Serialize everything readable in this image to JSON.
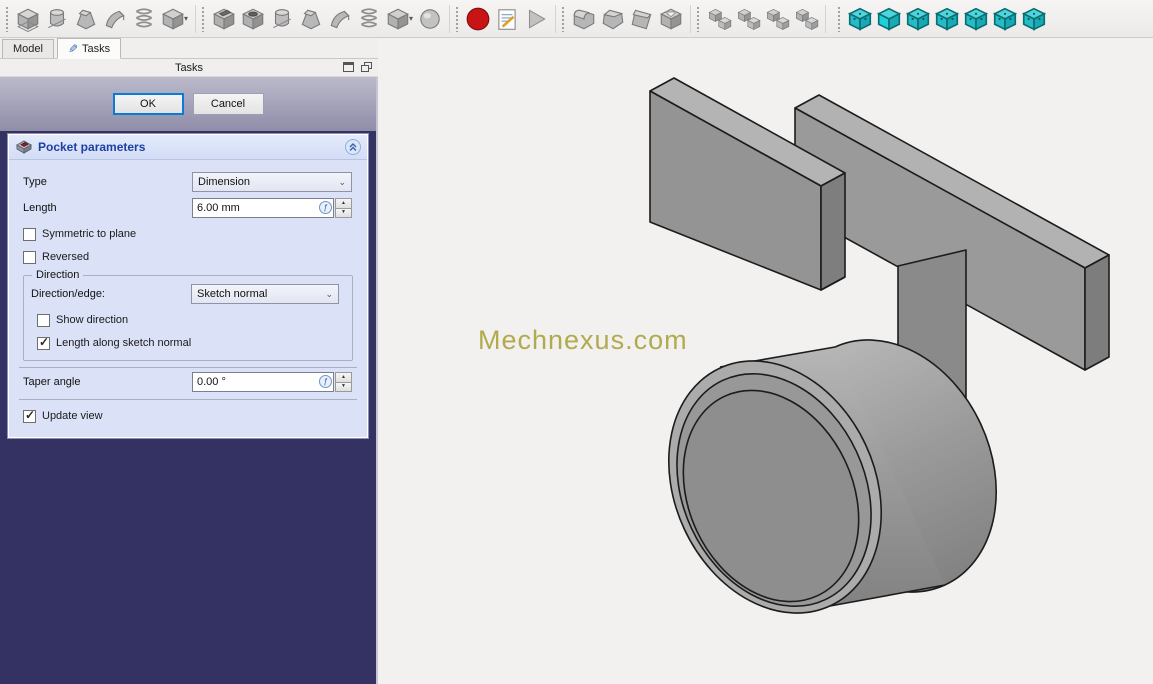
{
  "toolbar": {
    "groups": [
      {
        "name": "part-design-additive",
        "icons": [
          {
            "name": "pad-icon",
            "shape": "pad"
          },
          {
            "name": "revolution-icon",
            "shape": "rev"
          },
          {
            "name": "additive-loft-icon",
            "shape": "loft"
          },
          {
            "name": "additive-pipe-icon",
            "shape": "pipe"
          },
          {
            "name": "additive-helix-icon",
            "shape": "helix"
          },
          {
            "name": "additive-primitive-icon",
            "shape": "box",
            "dropdown": true
          }
        ]
      },
      {
        "name": "part-design-subtractive",
        "icons": [
          {
            "name": "pocket-icon",
            "shape": "pocket"
          },
          {
            "name": "hole-icon",
            "shape": "hole"
          },
          {
            "name": "groove-icon",
            "shape": "rev"
          },
          {
            "name": "subtractive-loft-icon",
            "shape": "loft"
          },
          {
            "name": "subtractive-pipe-icon",
            "shape": "pipe"
          },
          {
            "name": "subtractive-helix-icon",
            "shape": "helix"
          },
          {
            "name": "subtractive-primitive-icon",
            "shape": "box",
            "dropdown": true
          },
          {
            "name": "boolean-icon",
            "shape": "sphere"
          }
        ]
      },
      {
        "name": "macro",
        "icons": [
          {
            "name": "macro-record-icon",
            "shape": "record"
          },
          {
            "name": "macro-edit-icon",
            "shape": "doc"
          },
          {
            "name": "macro-execute-icon",
            "shape": "play"
          }
        ]
      },
      {
        "name": "dressup",
        "icons": [
          {
            "name": "fillet-icon",
            "shape": "fillet"
          },
          {
            "name": "chamfer-icon",
            "shape": "chamfer"
          },
          {
            "name": "draft-icon",
            "shape": "draft"
          },
          {
            "name": "thickness-icon",
            "shape": "thick"
          }
        ]
      },
      {
        "name": "transform",
        "icons": [
          {
            "name": "mirrored-icon",
            "shape": "cluster"
          },
          {
            "name": "linear-pattern-icon",
            "shape": "cluster"
          },
          {
            "name": "polar-pattern-icon",
            "shape": "cluster"
          },
          {
            "name": "multitransform-icon",
            "shape": "cluster"
          }
        ]
      },
      {
        "name": "views",
        "icons": [
          {
            "name": "view-isometric-icon",
            "shape": "vcube"
          },
          {
            "name": "view-front-icon",
            "shape": "vcubef"
          },
          {
            "name": "view-top-icon",
            "shape": "vcube"
          },
          {
            "name": "view-right-icon",
            "shape": "vcube"
          },
          {
            "name": "view-rear-icon",
            "shape": "vcube"
          },
          {
            "name": "view-bottom-icon",
            "shape": "vcube"
          },
          {
            "name": "view-left-icon",
            "shape": "vcube"
          }
        ]
      }
    ]
  },
  "tabs": [
    {
      "label": "Model",
      "active": false
    },
    {
      "label": "Tasks",
      "active": true
    }
  ],
  "dock": {
    "title": "Tasks"
  },
  "actions": {
    "ok": "OK",
    "cancel": "Cancel"
  },
  "pocket": {
    "title": "Pocket parameters",
    "type_label": "Type",
    "type_value": "Dimension",
    "length_label": "Length",
    "length_value": "6.00 mm",
    "symmetric_label": "Symmetric to plane",
    "symmetric_checked": false,
    "reversed_label": "Reversed",
    "reversed_checked": false,
    "direction_group_label": "Direction",
    "direction_edge_label": "Direction/edge:",
    "direction_edge_value": "Sketch normal",
    "show_direction_label": "Show direction",
    "show_direction_checked": false,
    "length_along_label": "Length along sketch normal",
    "length_along_checked": true,
    "taper_label": "Taper angle",
    "taper_value": "0.00 °",
    "update_view_label": "Update view",
    "update_view_checked": true
  },
  "viewport": {
    "watermark": "Mechnexus.com",
    "bg_top": "#363569",
    "bg_bottom": "#9596a9",
    "model_color": "#979797",
    "outline_color": "#1c1c1c"
  },
  "colors": {
    "accent_blue": "#1b3fa4",
    "ok_focus_border": "#0c7ad6",
    "record_red": "#c81414",
    "view_cube_teal": "#2cc5ce",
    "panel_navy": "#333263",
    "form_bg": "#dbe2f8"
  }
}
